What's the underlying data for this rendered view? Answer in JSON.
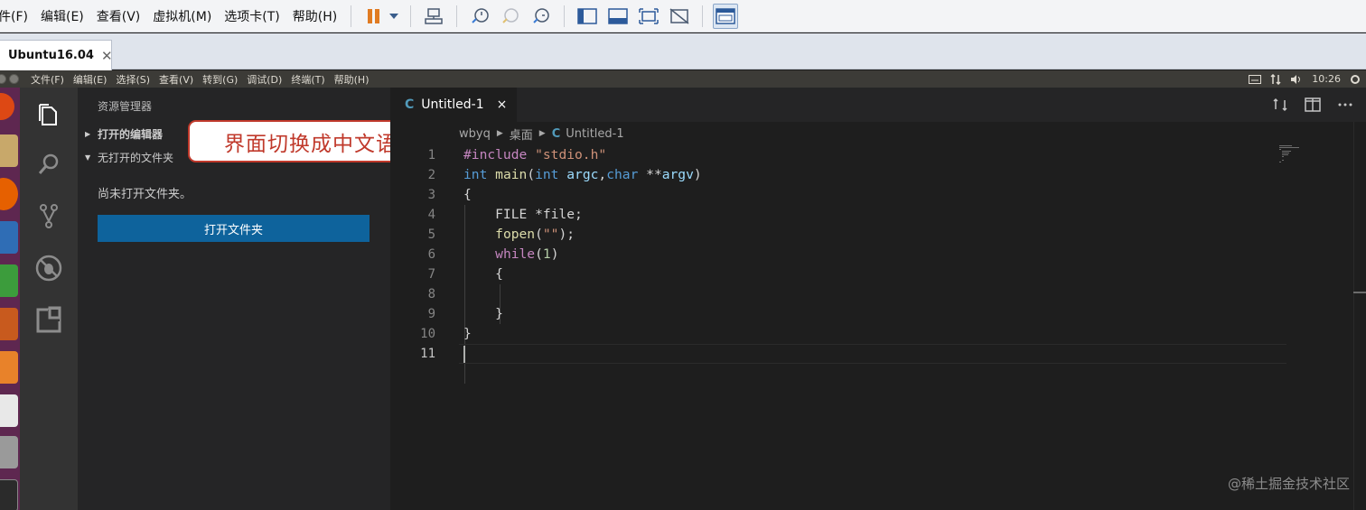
{
  "vmware": {
    "menu": [
      "件(F)",
      "编辑(E)",
      "查看(V)",
      "虚拟机(M)",
      "选项卡(T)",
      "帮助(H)"
    ],
    "tab_label": "Ubuntu16.04",
    "tab_close": "✕"
  },
  "ubuntu": {
    "menu": [
      "文件(F)",
      "编辑(E)",
      "选择(S)",
      "查看(V)",
      "转到(G)",
      "调试(D)",
      "终端(T)",
      "帮助(H)"
    ],
    "clock": "10:26"
  },
  "sidebar": {
    "title": "资源管理器",
    "open_editors": "打开的编辑器",
    "no_folder": "无打开的文件夹",
    "message": "尚未打开文件夹。",
    "open_folder_button": "打开文件夹"
  },
  "callout": "界面切换成中文语言",
  "editor": {
    "tab_icon": "C",
    "tab_name": "Untitled-1",
    "tab_close": "×",
    "breadcrumb": [
      "wbyq",
      "桌面",
      "Untitled-1"
    ],
    "line_numbers": [
      "1",
      "2",
      "3",
      "4",
      "5",
      "6",
      "7",
      "8",
      "9",
      "10",
      "11"
    ],
    "code": [
      "#include \"stdio.h\"",
      "int main(int argc,char **argv)",
      "{",
      "    FILE *file;",
      "    fopen(\"\");",
      "    while(1)",
      "    {",
      "",
      "    }",
      "}",
      ""
    ],
    "active_line": 11
  },
  "watermark": "@稀土掘金技术社区",
  "colors": {
    "accent": "#0e639c",
    "launcher": "#5e2750",
    "callout": "#c0392b"
  }
}
